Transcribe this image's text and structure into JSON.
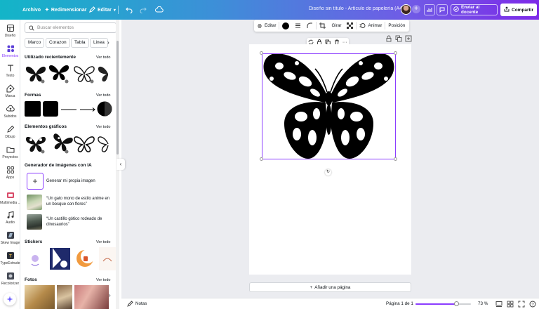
{
  "topbar": {
    "archivo": "Archivo",
    "redimensionar": "Redimensionar",
    "editar": "Editar",
    "doc_title": "Diseño sin título - Artículo de papelería (A4)",
    "enviar_docente": "Enviar al docente",
    "compartir": "Compartir"
  },
  "rail": [
    {
      "label": "Diseño",
      "icon": "layout-icon"
    },
    {
      "label": "Elementos",
      "icon": "elements-icon",
      "active": true
    },
    {
      "label": "Texto",
      "icon": "text-icon"
    },
    {
      "label": "Marca",
      "icon": "brand-icon"
    },
    {
      "label": "Subidos",
      "icon": "upload-icon"
    },
    {
      "label": "Dibujo",
      "icon": "draw-icon"
    },
    {
      "label": "Proyectos",
      "icon": "folder-icon"
    },
    {
      "label": "Apps",
      "icon": "apps-icon"
    },
    {
      "label": "Multimedia ...",
      "icon": "media-icon"
    },
    {
      "label": "Audio",
      "icon": "audio-icon"
    },
    {
      "label": "Skew Image",
      "icon": "skew-icon"
    },
    {
      "label": "TypeExtrude",
      "icon": "extrude-icon"
    },
    {
      "label": "Recolorizer",
      "icon": "recolor-icon"
    }
  ],
  "panel": {
    "search_placeholder": "Buscar elementos",
    "chips": [
      "Marco",
      "Corazon",
      "Tabla",
      "Linea"
    ],
    "sections": {
      "recent": "Utilizado recientemente",
      "shapes": "Formas",
      "graphics": "Elementos gráficos",
      "ai": "Generador de imágenes con IA",
      "stickers": "Stickers",
      "photos": "Fotos"
    },
    "see_all": "Ver todo",
    "ai_generate": "Generar mi propia imagen",
    "ai_prompt_1": "“Un gato mono de estilo anime en un bosque con flores”",
    "ai_prompt_2": "“Un castillo gótico rodeado de dinosaurios”"
  },
  "toolbar": {
    "editar": "Editar",
    "girar": "Girar",
    "animar": "Animar",
    "posicion": "Posición"
  },
  "canvas": {
    "add_page": "Añadir una página"
  },
  "bottombar": {
    "notas": "Notas",
    "pagina": "Página 1 de 1",
    "zoom": "73 %",
    "zoom_level": 0.73
  },
  "colors": {
    "accent": "#8b3dff",
    "fill": "#000000"
  }
}
